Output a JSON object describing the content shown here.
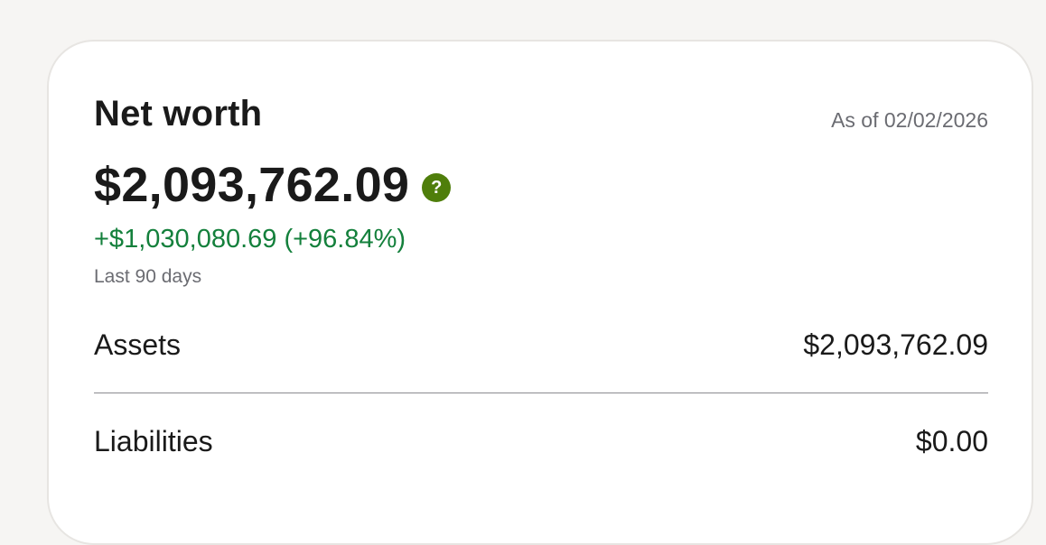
{
  "card": {
    "title": "Net worth",
    "as_of": "As of 02/02/2026",
    "amount": "$2,093,762.09",
    "help_icon": "question-icon",
    "change": "+$1,030,080.69 (+96.84%)",
    "period": "Last 90 days",
    "rows": [
      {
        "label": "Assets",
        "value": "$2,093,762.09"
      },
      {
        "label": "Liabilities",
        "value": "$0.00"
      }
    ]
  },
  "colors": {
    "background": "#f6f5f3",
    "card": "#ffffff",
    "positive_change": "#14803c",
    "help_icon": "#4f7e0b",
    "muted_text": "#6b6c72"
  }
}
